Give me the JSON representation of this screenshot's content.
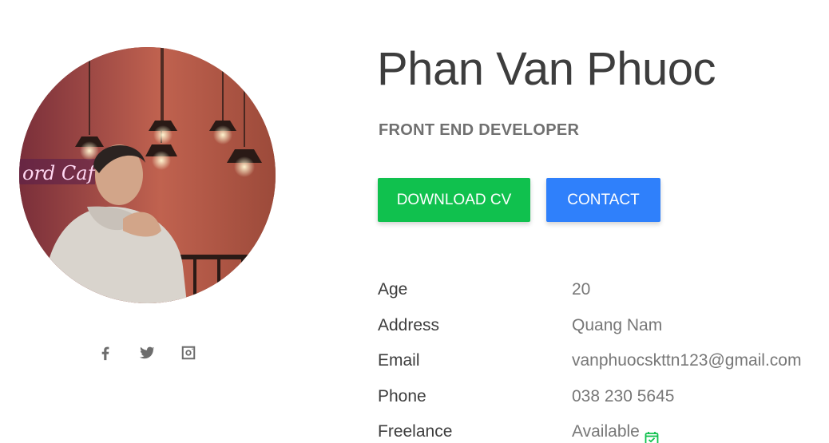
{
  "profile": {
    "name": "Phan Van Phuoc",
    "role": "FRONT END DEVELOPER",
    "avatar_alt": "profile-photo"
  },
  "buttons": {
    "download_label": "DOWNLOAD CV",
    "contact_label": "CONTACT"
  },
  "socials": [
    {
      "icon": "facebook-icon"
    },
    {
      "icon": "twitter-icon"
    },
    {
      "icon": "instagram-icon"
    }
  ],
  "info": {
    "rows": [
      {
        "label": "Age",
        "value": "20"
      },
      {
        "label": "Address",
        "value": "Quang Nam"
      },
      {
        "label": "Email",
        "value": "vanphuocskttn123@gmail.com"
      },
      {
        "label": "Phone",
        "value": "038 230 5645"
      },
      {
        "label": "Freelance",
        "value": "Available",
        "icon": "calendar-check-icon"
      }
    ]
  },
  "colors": {
    "download_button": "#10c14e",
    "contact_button": "#2f80fb",
    "heading_text": "#3d3d3d",
    "muted_text": "#777777",
    "check_icon": "#10c14e"
  }
}
